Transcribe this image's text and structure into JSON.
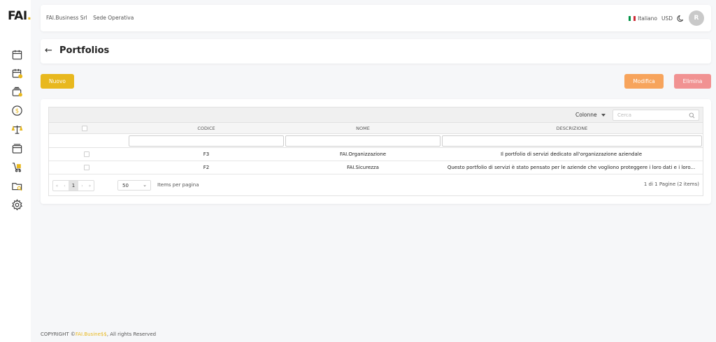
{
  "brand": {
    "logo_text": "FAI",
    "logo_dot": ".",
    "accent": "#e8b81e"
  },
  "sidebar": {
    "icons": [
      "calendar-icon",
      "calendar-user-icon",
      "card-stack-icon",
      "dollar-circle-icon",
      "balance-scale-icon",
      "archive-box-icon",
      "cart-icon",
      "folder-search-icon",
      "settings-cog-icon"
    ]
  },
  "header": {
    "company": "FAI.Business Srl",
    "location": "Sede Operativa",
    "language": "Italiano",
    "currency": "USD",
    "avatar_initial": "R"
  },
  "page": {
    "title": "Portfolios"
  },
  "actions": {
    "new_label": "Nuovo",
    "edit_label": "Modifica",
    "delete_label": "Elimina",
    "new_color": "#e8b81e",
    "edit_color": "#f7a45c",
    "delete_color": "#f19292"
  },
  "table": {
    "columns_label": "Colonne",
    "search_placeholder": "Cerca",
    "headers": {
      "code": "CODICE",
      "name": "NOME",
      "description": "DESCRIZIONE"
    },
    "rows": [
      {
        "code": "F3",
        "name": "FAI.Organizzazione",
        "description": "Il portfolio di servizi dedicato all'organizzazione aziendale"
      },
      {
        "code": "F2",
        "name": "FAI.Sicurezza",
        "description": "Questo portfolio di servizi è stato pensato per le aziende che vogliono proteggere i loro dati e i loro..."
      }
    ]
  },
  "pager": {
    "current_page": "1",
    "page_size": "50",
    "items_per_page_label": "Items per pagina",
    "info": "1 di 1 Pagine (2 items)"
  },
  "footer": {
    "prefix": "COPYRIGHT ©",
    "brand": "FAI.Busine$$",
    "suffix": ", All rights Reserved"
  }
}
